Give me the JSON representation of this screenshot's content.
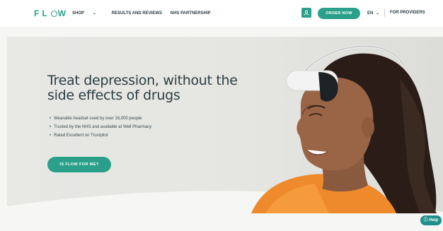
{
  "nav": {
    "logo": "FLOW",
    "links": [
      {
        "label": "SHOP",
        "has_dropdown": true
      },
      {
        "label": "RESULTS AND REVIEWS",
        "has_dropdown": false
      },
      {
        "label": "NHS PARTNERSHIP",
        "has_dropdown": false
      }
    ],
    "order_label": "ORDER NOW",
    "language": "EN",
    "providers_label": "FOR PROVIDERS",
    "user_icon": "user-icon"
  },
  "hero": {
    "headline": "Treat depression, without the side effects of drugs",
    "bullets": [
      "Wearable headset used by over 16,000 people",
      "Trusted by the NHS and available at Well Pharmacy",
      "Rated Excellent on Trustpilot"
    ],
    "cta_label": "IS FLOW FOR ME?"
  },
  "help_label": "Help",
  "colors": {
    "accent": "#2aa08a",
    "text": "#2c3e43",
    "hero_bg": "#e6e6e3"
  }
}
